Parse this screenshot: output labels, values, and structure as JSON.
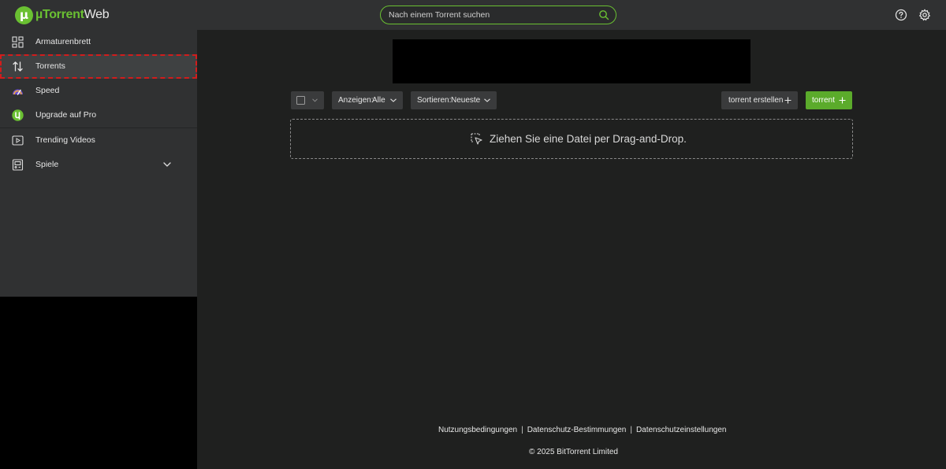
{
  "app": {
    "logo_mark": "µ",
    "brand": "µTorrent",
    "brand_suffix": "Web"
  },
  "search": {
    "placeholder": "Nach einem Torrent suchen",
    "icon": "search-icon"
  },
  "header_icons": [
    "help-icon",
    "gear-icon"
  ],
  "sidebar": {
    "items": [
      {
        "label": "Armaturenbrett",
        "icon": "dashboard-grid-icon"
      },
      {
        "label": "Torrents",
        "icon": "transfer-arrows-icon",
        "active": true
      },
      {
        "label": "Speed",
        "icon": "speedometer-icon"
      },
      {
        "label": "Upgrade auf Pro",
        "icon": "utorrent-logo-icon"
      },
      {
        "label": "Trending Videos",
        "icon": "video-play-icon"
      },
      {
        "label": "Spiele",
        "icon": "arcade-icon",
        "expandable": true
      }
    ]
  },
  "toolbar": {
    "show_label": "Anzeigen:",
    "show_value": "Alle",
    "sort_label": "Sortieren:",
    "sort_value": "Neueste",
    "create_label": "torrent erstellen",
    "add_label": "torrent"
  },
  "dropzone": {
    "text": "Ziehen Sie eine Datei per Drag-and-Drop."
  },
  "footer": {
    "links": [
      "Nutzungsbedingungen",
      "Datenschutz-Bestimmungen",
      "Datenschutzeinstellungen"
    ],
    "separator": "|",
    "copyright": "© 2025 BitTorrent Limited"
  },
  "colors": {
    "accent": "#6ac032",
    "button_green": "#5bab2b",
    "sidebar_bg": "#303132",
    "main_bg": "#1f201f",
    "active_outline": "#d21c1c"
  }
}
